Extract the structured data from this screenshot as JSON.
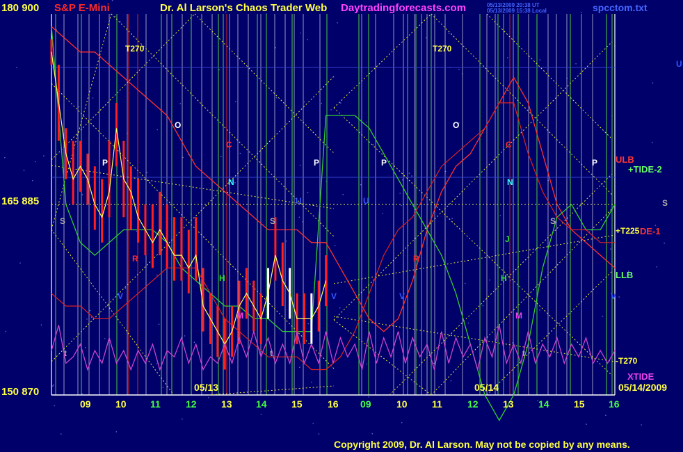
{
  "header": {
    "left_numbers": "180  900",
    "instrument": "S&P E-Mini",
    "title": "Dr. Al Larson's Chaos Trader Web",
    "site": "Daytradingforecasts.com",
    "timestamp_ut": "05/13/2009 20:38 UT",
    "timestamp_local": "05/13/2009 15:38 Local",
    "filename": "spcctom.txt"
  },
  "footer": {
    "copyright": "Copyright 2009, Dr. Al Larson. May not be copied by any means."
  },
  "colors": {
    "background": "#00006a",
    "grid_white": "#ffffff",
    "grid_green": "#3fae3f",
    "grid_red": "#b82020",
    "dotted": "#e6e63c",
    "price_bars": "#ff2020",
    "upper_band": "#ff3030",
    "lower_band": "#33cc33",
    "tide_curve": "#cc44cc"
  },
  "chart_data": {
    "type": "line",
    "title": "S&P E-Mini",
    "y_left_labels": [
      {
        "text": "180  900",
        "value": 900
      },
      {
        "text": "165  885",
        "value": 885
      },
      {
        "text": "150  870",
        "value": 870
      }
    ],
    "ylim": [
      870,
      900
    ],
    "x_ticks": [
      "09",
      "10",
      "11",
      "12",
      "13",
      "14",
      "15",
      "16",
      "09",
      "10",
      "11",
      "12",
      "13",
      "14",
      "15",
      "16"
    ],
    "x_tick_colors": [
      "#ffff44",
      "#ffff44",
      "#44ff44",
      "#44ff44",
      "#ffff44",
      "#44ff44",
      "#ffff44",
      "#ffff44",
      "#44ff44",
      "#ffff44",
      "#ffff44",
      "#44ff44",
      "#ffff44",
      "#44ff44",
      "#ffff44",
      "#44ff44"
    ],
    "date_labels": [
      "05/13",
      "05/14",
      "05/14/2009"
    ],
    "series_labels": [
      {
        "text": "ULB",
        "color": "#ff3333"
      },
      {
        "text": "+TIDE-2",
        "color": "#66ff66"
      },
      {
        "text": "+T225",
        "color": "#ffff44"
      },
      {
        "text": "DE-1",
        "color": "#ff3333"
      },
      {
        "text": "LLB",
        "color": "#66ff66"
      },
      {
        "text": "-T270",
        "color": "#ffff44"
      },
      {
        "text": "XTIDE",
        "color": "#ee44ee"
      }
    ],
    "markers": [
      {
        "text": "T270",
        "color": "#ffff44"
      },
      {
        "text": "T270",
        "color": "#ffff44"
      },
      {
        "text": "O",
        "color": "#ffffff"
      },
      {
        "text": "O",
        "color": "#ffffff"
      },
      {
        "text": "P",
        "color": "#ffffff"
      },
      {
        "text": "P",
        "color": "#ffffff"
      },
      {
        "text": "P",
        "color": "#ffffff"
      },
      {
        "text": "P",
        "color": "#ffffff"
      },
      {
        "text": "C",
        "color": "#ff3030"
      },
      {
        "text": "C",
        "color": "#ff3030"
      },
      {
        "text": "N",
        "color": "#33ffff"
      },
      {
        "text": "N",
        "color": "#33ffff"
      },
      {
        "text": "U",
        "color": "#3355ff"
      },
      {
        "text": "U",
        "color": "#3355ff"
      },
      {
        "text": "U",
        "color": "#3355ff"
      },
      {
        "text": "S",
        "color": "#aaaaaa"
      },
      {
        "text": "S",
        "color": "#aaaaaa"
      },
      {
        "text": "S",
        "color": "#aaaaaa"
      },
      {
        "text": "S",
        "color": "#aaaaaa"
      },
      {
        "text": "R",
        "color": "#ff3030"
      },
      {
        "text": "R",
        "color": "#ff3030"
      },
      {
        "text": "H",
        "color": "#33dd33"
      },
      {
        "text": "H",
        "color": "#33dd33"
      },
      {
        "text": "J",
        "color": "#33dd33"
      },
      {
        "text": "V",
        "color": "#3355ff"
      },
      {
        "text": "V",
        "color": "#3355ff"
      },
      {
        "text": "V",
        "color": "#3355ff"
      },
      {
        "text": "V",
        "color": "#3355ff"
      },
      {
        "text": "M",
        "color": "#ee44ee"
      },
      {
        "text": "M",
        "color": "#ee44ee"
      },
      {
        "text": "t",
        "color": "#aaaaaa"
      },
      {
        "text": "t",
        "color": "#aaaaaa"
      },
      {
        "text": "t",
        "color": "#aaaaaa"
      }
    ],
    "price": {
      "x_hours": [
        8.4,
        8.6,
        8.8,
        9.0,
        9.2,
        9.4,
        9.6,
        9.8,
        10.0,
        10.2,
        10.4,
        10.6,
        10.8,
        11.0,
        11.2,
        11.4,
        11.6,
        11.8,
        12.0,
        12.2,
        12.4,
        12.6,
        12.8,
        13.0,
        13.2,
        13.4,
        13.6,
        13.8,
        14.0,
        14.2,
        14.4,
        14.6,
        14.8,
        15.0,
        15.2,
        15.4,
        15.6,
        15.8,
        16.0
      ],
      "close": [
        897,
        893,
        889,
        887,
        888,
        887,
        885,
        884,
        886,
        891,
        887,
        886,
        884,
        883,
        882,
        883,
        882,
        881,
        881,
        880,
        881,
        877,
        876,
        875,
        874,
        875,
        877,
        878,
        877,
        876,
        878,
        881,
        879,
        878,
        876,
        876,
        876,
        877,
        879
      ],
      "high": [
        898,
        896,
        891,
        890,
        890,
        889,
        888,
        887,
        890,
        893,
        890,
        888,
        887,
        885,
        885,
        886,
        885,
        884,
        884,
        883,
        884,
        880,
        878,
        877,
        876,
        877,
        879,
        880,
        879,
        878,
        880,
        884,
        882,
        880,
        878,
        878,
        878,
        879,
        881
      ],
      "low": [
        896,
        890,
        887,
        885,
        886,
        885,
        883,
        882,
        884,
        888,
        884,
        883,
        882,
        881,
        880,
        881,
        880,
        879,
        879,
        878,
        879,
        875,
        874,
        873,
        872,
        873,
        874,
        876,
        875,
        874,
        876,
        879,
        877,
        876,
        874,
        874,
        874,
        875,
        877
      ]
    },
    "upper_band": {
      "x_hours": [
        8.4,
        8.8,
        9.2,
        9.6,
        10.0,
        10.4,
        10.8,
        11.2,
        11.6,
        12.0,
        12.4,
        12.8,
        13.2,
        13.6,
        14.0,
        14.4,
        14.8,
        15.2,
        15.6,
        16.0,
        16.4,
        16.8,
        17.2,
        17.6,
        18.0,
        18.4,
        18.8,
        19.2,
        19.6,
        20.0,
        20.4,
        20.8,
        21.2,
        21.6,
        22.0,
        22.4,
        22.8,
        23.2,
        23.6,
        24.0
      ],
      "values": [
        899,
        898,
        897,
        897,
        896,
        895,
        894,
        893,
        892,
        890,
        888,
        887,
        886,
        885,
        884,
        883,
        883,
        883,
        882,
        882,
        880,
        878,
        876,
        875,
        876,
        879,
        883,
        886,
        888,
        889,
        891,
        893,
        895,
        893,
        889,
        885,
        883,
        882,
        881,
        880
      ]
    },
    "lower_band": {
      "x_hours": [
        8.4,
        8.8,
        9.2,
        9.6,
        10.0,
        10.4,
        10.8,
        11.2,
        11.6,
        12.0,
        12.4,
        12.8,
        13.2,
        13.6,
        14.0,
        14.4,
        14.8,
        15.2,
        15.6,
        16.0,
        16.4,
        16.8,
        17.2,
        17.6,
        18.0,
        18.4,
        18.8,
        19.2,
        19.6,
        20.0,
        20.4,
        20.8,
        21.2,
        21.6,
        22.0,
        22.4,
        22.8,
        23.2,
        23.6,
        24.0
      ],
      "values": [
        899,
        885,
        882,
        881,
        882,
        883,
        883,
        883,
        882,
        880,
        879,
        878,
        877,
        877,
        876,
        876,
        875,
        875,
        875,
        892,
        892,
        892,
        891,
        889,
        887,
        885,
        883,
        881,
        878,
        874,
        870,
        868,
        870,
        874,
        880,
        884,
        885,
        883,
        883,
        885
      ]
    },
    "lower_red_curve": {
      "x_hours": [
        8.4,
        8.8,
        9.2,
        9.6,
        10.0,
        10.4,
        10.8,
        11.2,
        11.6,
        12.0,
        12.4,
        12.8,
        13.2,
        13.6,
        14.0,
        14.4,
        14.8,
        15.2,
        15.6,
        16.0,
        16.4,
        16.8,
        17.2,
        17.6,
        18.0,
        18.4,
        18.8,
        19.2,
        19.6,
        20.0,
        20.4,
        20.8,
        21.2,
        21.6,
        22.0,
        22.4,
        22.8,
        23.2,
        23.6,
        24.0
      ],
      "values": [
        878,
        877,
        877,
        876,
        876,
        877,
        878,
        879,
        880,
        880,
        880,
        878,
        876,
        875,
        874,
        873,
        873,
        873,
        872,
        872,
        873,
        875,
        878,
        881,
        883,
        884,
        886,
        888,
        889,
        890,
        891,
        893,
        893,
        889,
        886,
        884,
        883,
        883,
        882,
        882
      ]
    },
    "tide": {
      "x_hours": [
        8.4,
        8.6,
        8.8,
        9.0,
        9.2,
        9.4,
        9.6,
        9.8,
        10.0,
        10.2,
        10.4,
        10.6,
        10.8,
        11.0,
        11.2,
        11.4,
        11.6,
        11.8,
        12.0,
        12.2,
        12.4,
        12.6,
        12.8,
        13.0,
        13.2,
        13.4,
        13.6,
        13.8,
        14.0,
        14.2,
        14.4,
        14.6,
        14.8,
        15.0,
        15.2,
        15.4,
        15.6,
        15.8,
        16.0,
        16.2,
        16.4,
        16.6,
        16.8,
        17.0,
        17.2,
        17.4,
        17.6,
        17.8,
        18.0,
        18.2,
        18.4,
        18.6,
        18.8,
        19.0,
        19.2,
        19.4,
        19.6,
        19.8,
        20.0,
        20.2,
        20.4,
        20.6,
        20.8,
        21.0,
        21.2,
        21.4,
        21.6,
        21.8,
        22.0,
        22.2,
        22.4,
        22.6,
        22.8,
        23.0,
        23.2,
        23.4,
        23.6,
        23.8,
        24.0
      ],
      "values": [
        873.5,
        875.5,
        872.5,
        873,
        874,
        872,
        873.5,
        872.5,
        874.5,
        872.5,
        873.5,
        872,
        873.5,
        872.5,
        874,
        872,
        873.5,
        873,
        874.5,
        872.5,
        874,
        872,
        873,
        872.5,
        874,
        872.5,
        874.5,
        873,
        875,
        873,
        874.5,
        872.5,
        874,
        872.5,
        875,
        872.5,
        874,
        872.5,
        875,
        872.5,
        874.5,
        873,
        874,
        872,
        875,
        872.5,
        874.5,
        873,
        875,
        872.5,
        874.5,
        873,
        874,
        872,
        875,
        872.5,
        874.5,
        873,
        874,
        872,
        874.5,
        873,
        875.5,
        872.5,
        874,
        872.5,
        875,
        872.5,
        874,
        873,
        874.5,
        872.5,
        874,
        873,
        874.5,
        872.5,
        873.5,
        872.5,
        873.5
      ]
    }
  }
}
